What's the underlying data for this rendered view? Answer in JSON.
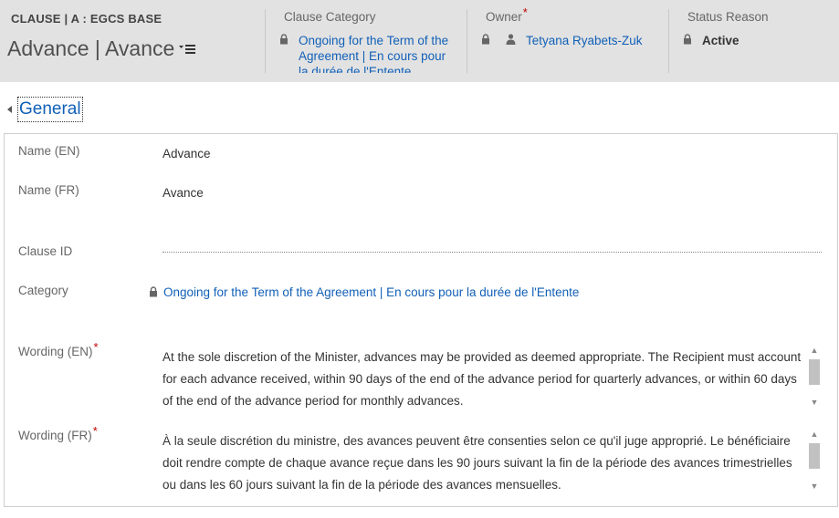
{
  "header": {
    "entity_type": "CLAUSE | A : EGCS BASE",
    "record_title": "Advance | Avance",
    "fields": {
      "clause_category": {
        "label": "Clause Category",
        "value": "Ongoing for the Term of the Agreement | En cours pour la durée de l'Entente",
        "locked": true
      },
      "owner": {
        "label": "Owner",
        "required_marker": "*",
        "value": "Tetyana Ryabets-Zuk",
        "locked": true,
        "icon": "user-icon"
      },
      "status_reason": {
        "label": "Status Reason",
        "value": "Active",
        "locked": true
      }
    }
  },
  "section": {
    "title": "General",
    "expanded": true
  },
  "form": {
    "name_en": {
      "label": "Name (EN)",
      "value": "Advance"
    },
    "name_fr": {
      "label": "Name (FR)",
      "value": "Avance"
    },
    "clause_id": {
      "label": "Clause ID",
      "value": ""
    },
    "category": {
      "label": "Category",
      "value": "Ongoing for the Term of the Agreement | En cours pour la durée de l'Entente",
      "locked": true
    },
    "wording_en": {
      "label": "Wording (EN)",
      "required_marker": "*",
      "value": "At the sole discretion of the Minister, advances may be provided as deemed appropriate. The Recipient must account for each advance received, within 90 days of the end of the advance period for quarterly advances, or within 60 days of the end of the advance period for monthly advances."
    },
    "wording_fr": {
      "label": "Wording (FR)",
      "required_marker": "*",
      "value": "À la seule discrétion du ministre, des avances peuvent être consenties selon ce qu'il juge approprié. Le bénéficiaire doit rendre compte de chaque avance reçue dans les 90 jours suivant la fin de la période des avances trimestrielles ou dans les 60 jours suivant la fin de la période des avances mensuelles."
    }
  },
  "colors": {
    "header_bg": "#e2e2e2",
    "link": "#1160b7",
    "required": "#c00000"
  }
}
